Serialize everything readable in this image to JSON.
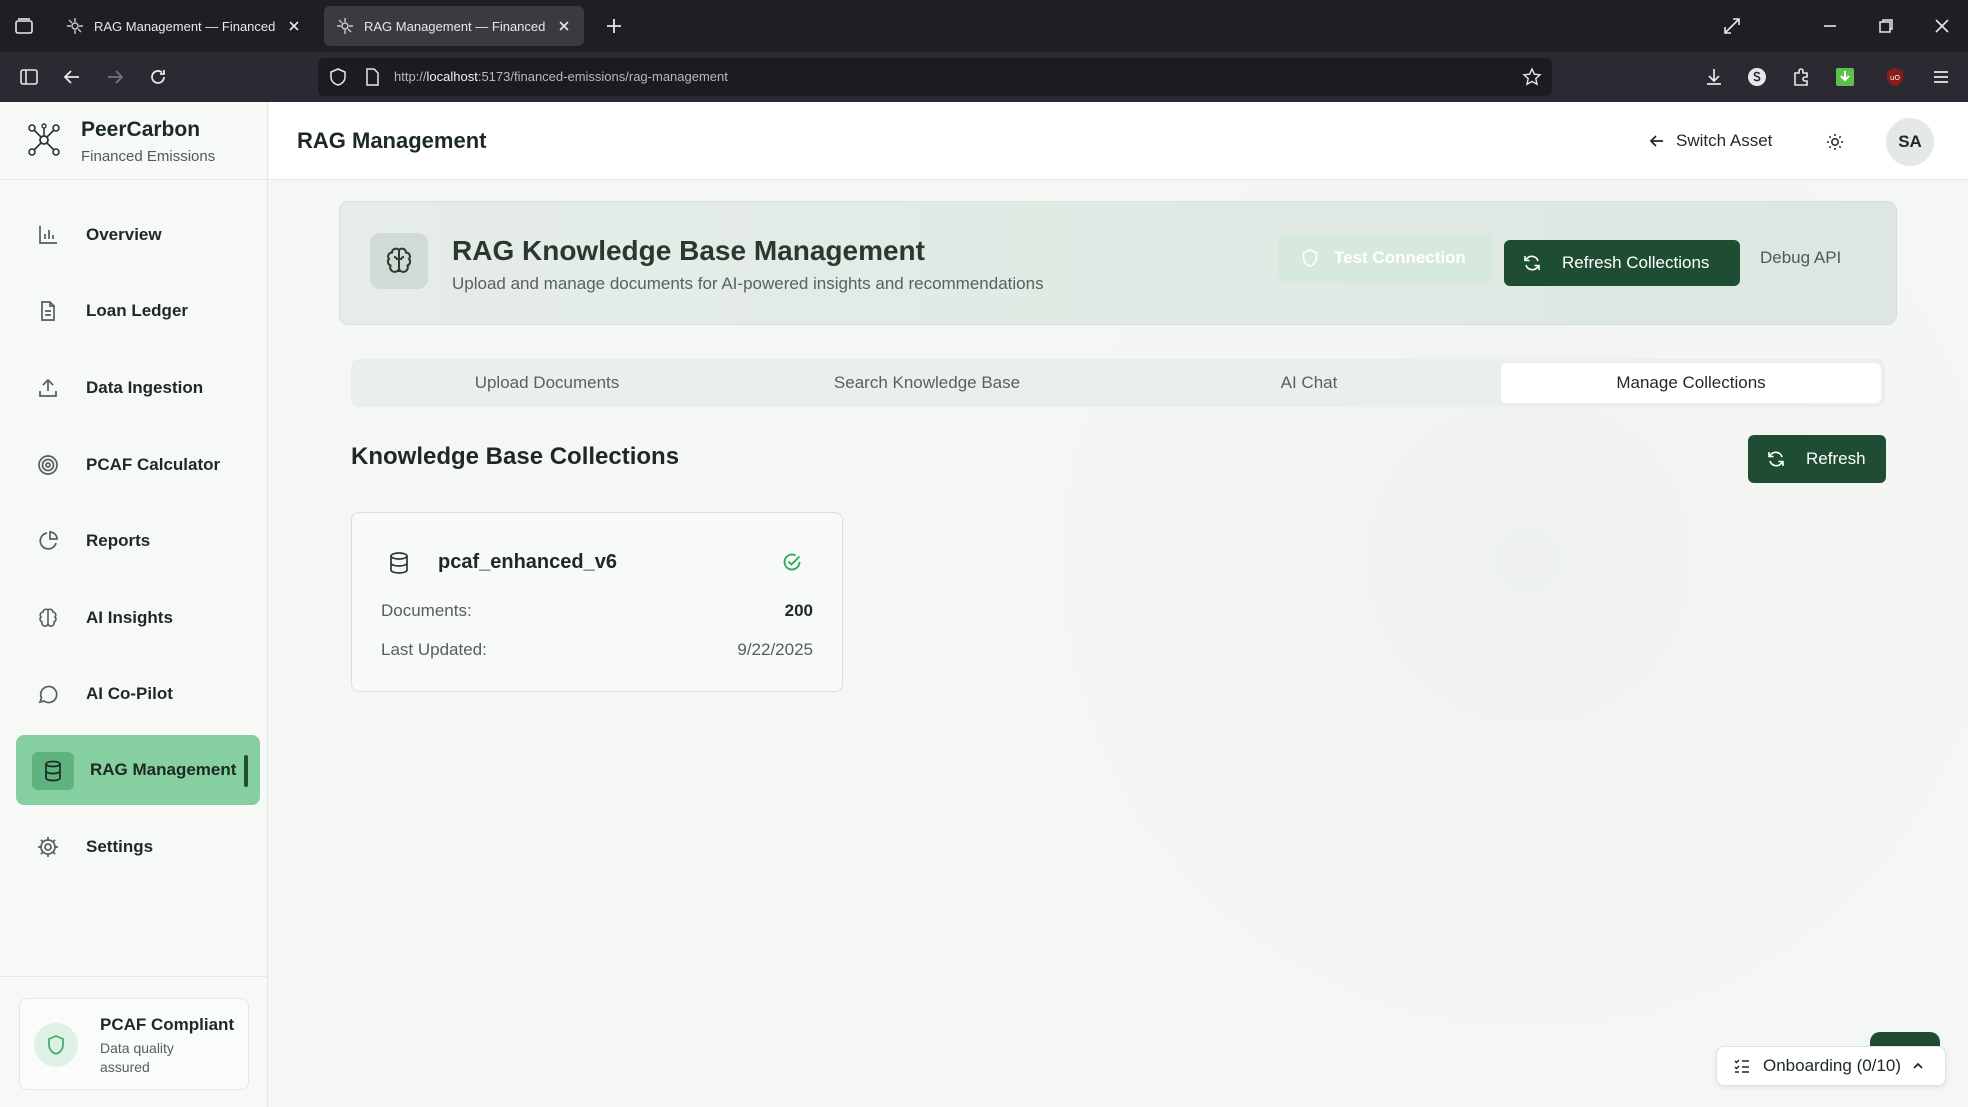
{
  "browser": {
    "tabs": [
      {
        "title": "RAG Management — Financed Emissions",
        "active": false
      },
      {
        "title": "RAG Management — Financed Emissions",
        "active": true
      }
    ],
    "url_prefix": "http://",
    "url_host": "localhost",
    "url_rest": ":5173/financed-emissions/rag-management"
  },
  "brand": {
    "name": "PeerCarbon",
    "subtitle": "Financed Emissions"
  },
  "sidebar": {
    "items": [
      {
        "label": "Overview",
        "icon": "bar-chart-icon"
      },
      {
        "label": "Loan Ledger",
        "icon": "file-text-icon"
      },
      {
        "label": "Data Ingestion",
        "icon": "upload-icon"
      },
      {
        "label": "PCAF Calculator",
        "icon": "target-icon"
      },
      {
        "label": "Reports",
        "icon": "pie-chart-icon"
      },
      {
        "label": "AI Insights",
        "icon": "brain-icon"
      },
      {
        "label": "AI Co-Pilot",
        "icon": "chat-icon"
      },
      {
        "label": "RAG Management",
        "icon": "database-icon",
        "active": true
      },
      {
        "label": "Settings",
        "icon": "gear-icon"
      }
    ],
    "footer": {
      "title": "PCAF Compliant",
      "subtitle": "Data quality assured"
    }
  },
  "header": {
    "title": "RAG Management",
    "switch_asset": "Switch Asset",
    "avatar_initials": "SA"
  },
  "hero": {
    "title": "RAG Knowledge Base Management",
    "subtitle": "Upload and manage documents for AI-powered insights and recommendations",
    "test_connection": "Test Connection",
    "refresh_collections": "Refresh Collections",
    "debug_api": "Debug API"
  },
  "tabs": [
    {
      "label": "Upload Documents",
      "active": false
    },
    {
      "label": "Search Knowledge Base",
      "active": false
    },
    {
      "label": "AI Chat",
      "active": false
    },
    {
      "label": "Manage Collections",
      "active": true
    }
  ],
  "collections": {
    "title": "Knowledge Base Collections",
    "refresh_label": "Refresh",
    "items": [
      {
        "name": "pcaf_enhanced_v6",
        "documents_label": "Documents:",
        "documents": "200",
        "updated_label": "Last Updated:",
        "updated": "9/22/2025",
        "status": "connected"
      }
    ]
  },
  "onboarding": {
    "label": "Onboarding (0/10)"
  },
  "colors": {
    "accent": "#1e4d33",
    "active_nav": "#86cfa0",
    "status_ok": "#2fa655"
  }
}
